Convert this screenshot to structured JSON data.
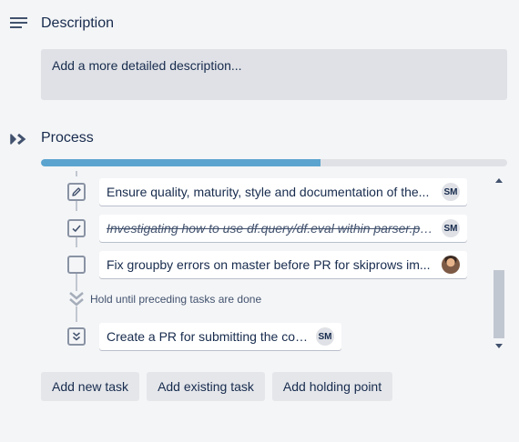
{
  "description": {
    "heading": "Description",
    "placeholder": "Add a more detailed description..."
  },
  "process": {
    "heading": "Process",
    "progress_fraction": 0.6,
    "tasks": [
      {
        "text": "Ensure quality, maturity, style and documentation of the...",
        "assignee": "SM",
        "state": "in-progress",
        "icon": "pencil-icon"
      },
      {
        "text": "Investigating how to use df.query/df.eval within parser.py...",
        "assignee": "SM",
        "state": "done",
        "icon": "checkmark-icon"
      },
      {
        "text": "Fix groupby errors on master before PR for skiprows im...",
        "assignee": "",
        "state": "todo",
        "icon": ""
      }
    ],
    "holding_point": "Hold until preceding tasks are done",
    "held_tasks": [
      {
        "text": "Create a PR for submitting the code",
        "assignee": "SM",
        "state": "held",
        "icon": "double-chevron-down-icon"
      }
    ]
  },
  "actions": {
    "add_new_task": "Add new task",
    "add_existing_task": "Add existing task",
    "add_holding_point": "Add holding point"
  },
  "colors": {
    "progress_fill": "#5ba4cf",
    "progress_track": "#dfe1e6",
    "background": "#f4f5f7"
  }
}
